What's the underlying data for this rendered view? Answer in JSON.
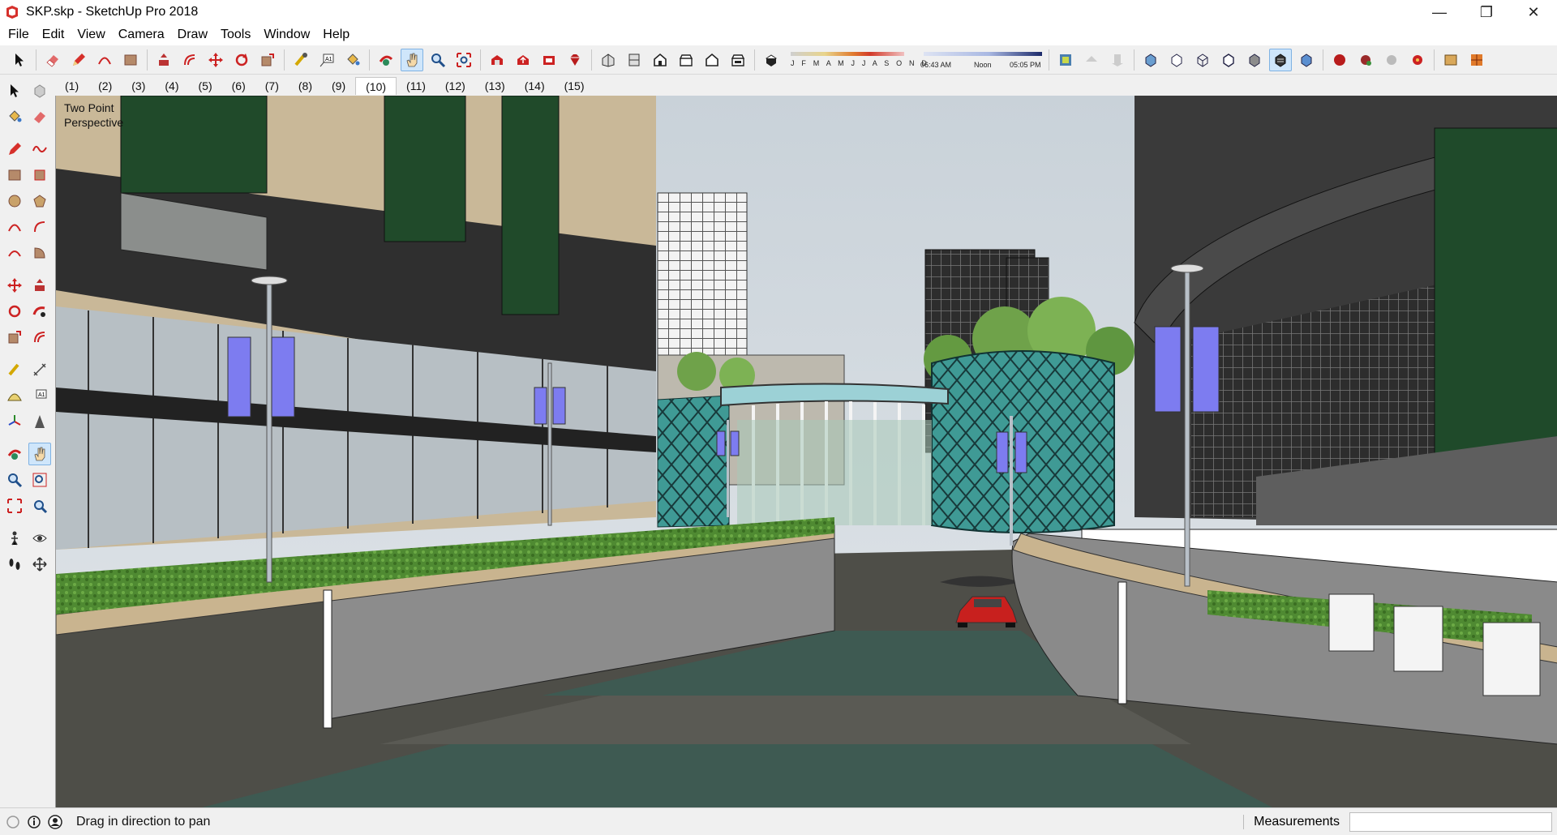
{
  "window": {
    "title": "SKP.skp - SketchUp Pro 2018",
    "minimize_glyph": "—",
    "restore_glyph": "❐",
    "close_glyph": "✕"
  },
  "menu": [
    "File",
    "Edit",
    "View",
    "Camera",
    "Draw",
    "Tools",
    "Window",
    "Help"
  ],
  "toolbar": {
    "shadow_months": "J F M A M J J A S O N D",
    "shadow_time_start": "06:43 AM",
    "shadow_time_mid": "Noon",
    "shadow_time_end": "05:05 PM"
  },
  "scene_tabs": [
    "(1)",
    "(2)",
    "(3)",
    "(4)",
    "(5)",
    "(6)",
    "(7)",
    "(8)",
    "(9)",
    "(10)",
    "(11)",
    "(12)",
    "(13)",
    "(14)",
    "(15)"
  ],
  "active_scene": "(10)",
  "viewport": {
    "camera_label": "Two Point Perspective"
  },
  "status": {
    "hint": "Drag in direction to pan",
    "measurements_label": "Measurements",
    "measurements_value": ""
  },
  "colors": {
    "banner": "#7d7cf0",
    "glass": "#3a8f8a",
    "building": "#c9b898",
    "wall_dark": "#2b2b2b",
    "ramp_gray": "#8c8c8c",
    "road": "#4a4a44",
    "greenery": "#5a8f3a",
    "car": "#c8201e"
  }
}
